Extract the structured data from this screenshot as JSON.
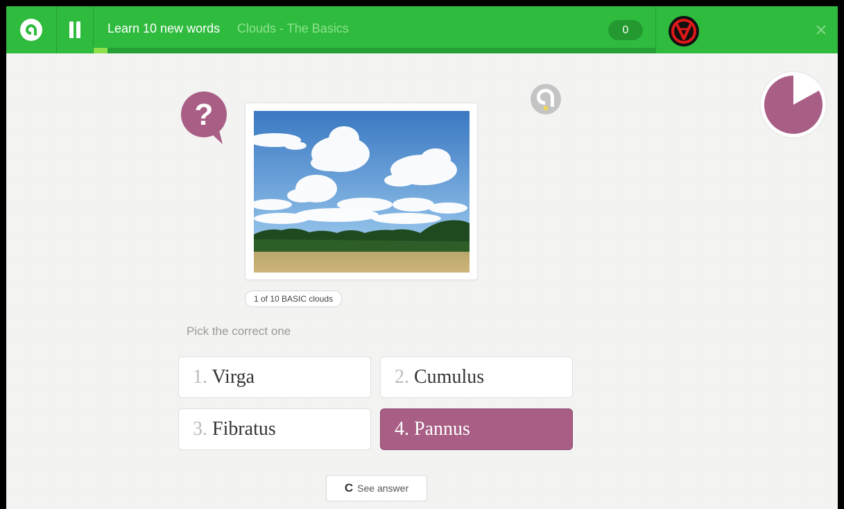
{
  "topbar": {
    "title": "Learn 10 new words",
    "subtitle": "Clouds - The Basics",
    "score": "0",
    "progress_fraction": 0.025,
    "close_glyph": "×"
  },
  "question": {
    "icon": "question-bubble-icon",
    "icon_glyph": "?",
    "tag": "1 of 10 BASIC clouds",
    "prompt": "Pick the correct one"
  },
  "options": [
    {
      "num": "1.",
      "label": "Virga",
      "selected": false
    },
    {
      "num": "2.",
      "label": "Cumulus",
      "selected": false
    },
    {
      "num": "3.",
      "label": "Fibratus",
      "selected": false
    },
    {
      "num": "4.",
      "label": "Pannus",
      "selected": true
    }
  ],
  "see_answer": {
    "label": "See answer",
    "icon": "refresh-icon",
    "icon_glyph": "C"
  },
  "timer": {
    "remaining_fraction": 0.83
  },
  "colors": {
    "brand_green": "#2fbb3e",
    "accent_purple": "#a85e85"
  }
}
